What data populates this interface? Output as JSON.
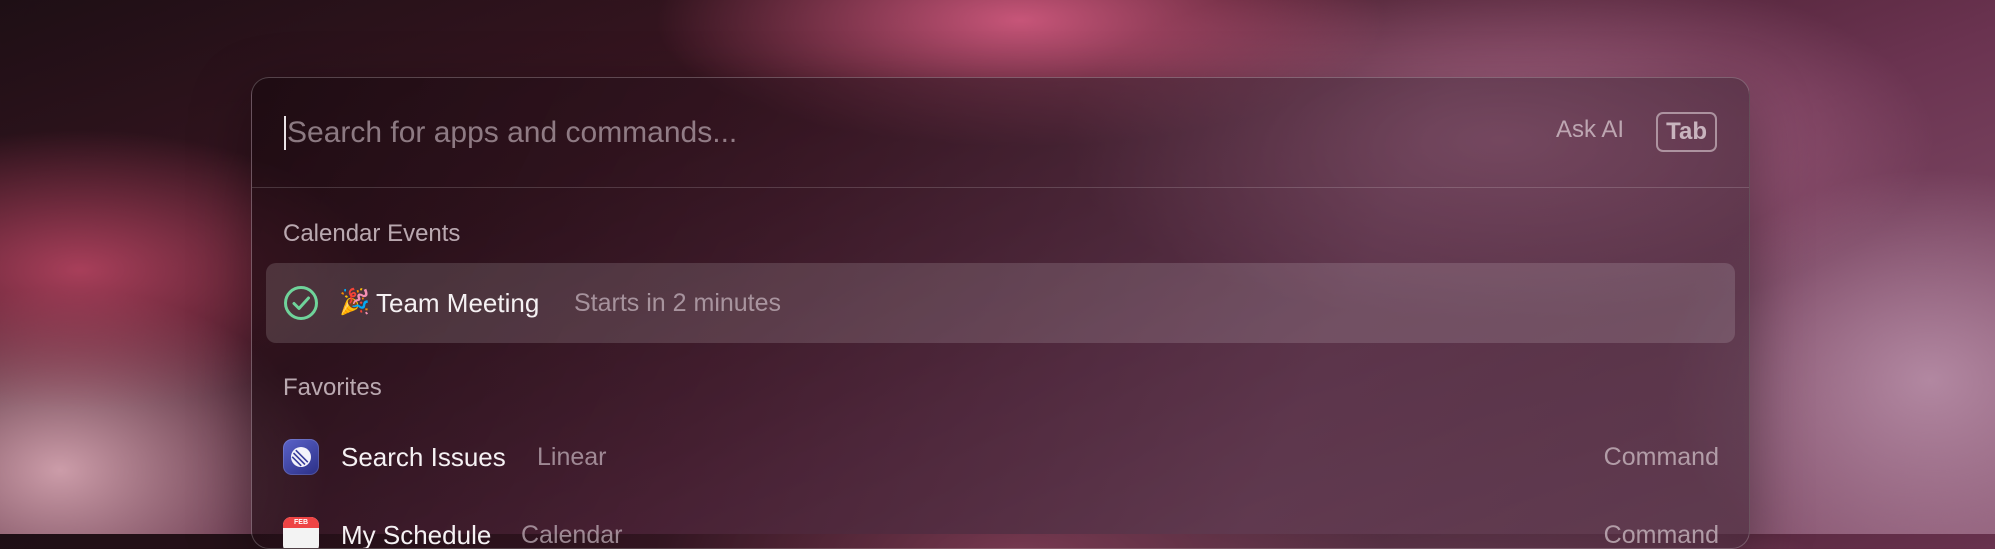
{
  "search": {
    "placeholder": "Search for apps and commands...",
    "ask_ai_label": "Ask AI",
    "tab_key_label": "Tab"
  },
  "sections": [
    {
      "title": "Calendar Events",
      "items": [
        {
          "icon": "check-circle-icon",
          "emoji": "🎉",
          "title": "Team Meeting",
          "subtitle": "Starts in 2 minutes",
          "accessory": "",
          "selected": true
        }
      ]
    },
    {
      "title": "Favorites",
      "items": [
        {
          "icon": "linear-icon",
          "title": "Search Issues",
          "subtitle": "Linear",
          "accessory": "Command",
          "selected": false
        },
        {
          "icon": "calendar-icon",
          "calendar_icon_label": "FEB",
          "title": "My Schedule",
          "subtitle": "Calendar",
          "accessory": "Command",
          "selected": false
        }
      ]
    }
  ],
  "colors": {
    "check_green": "#6fd39a",
    "linear_brand": "#5e6ad2"
  }
}
